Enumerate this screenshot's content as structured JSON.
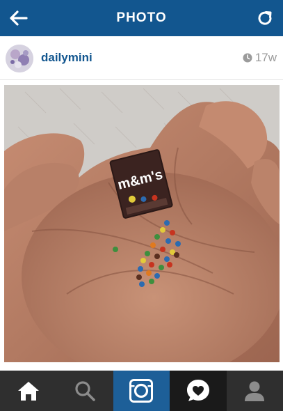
{
  "header": {
    "title": "PHOTO",
    "back_icon": "back-arrow-icon",
    "refresh_icon": "refresh-icon"
  },
  "post": {
    "username": "dailymini",
    "time_ago": "17w",
    "clock_icon": "clock-icon"
  },
  "photo": {
    "candy_bag_text": "m&m's"
  },
  "tabbar": {
    "tabs": [
      {
        "icon": "home-icon"
      },
      {
        "icon": "search-icon"
      },
      {
        "icon": "camera-icon",
        "active": true
      },
      {
        "icon": "news-heart-icon"
      },
      {
        "icon": "profile-icon"
      }
    ]
  },
  "colors": {
    "header_bg": "#12568f",
    "username": "#12568f",
    "tabbar_bg": "#2f2f2f",
    "active_tab": "#1d5f98"
  }
}
